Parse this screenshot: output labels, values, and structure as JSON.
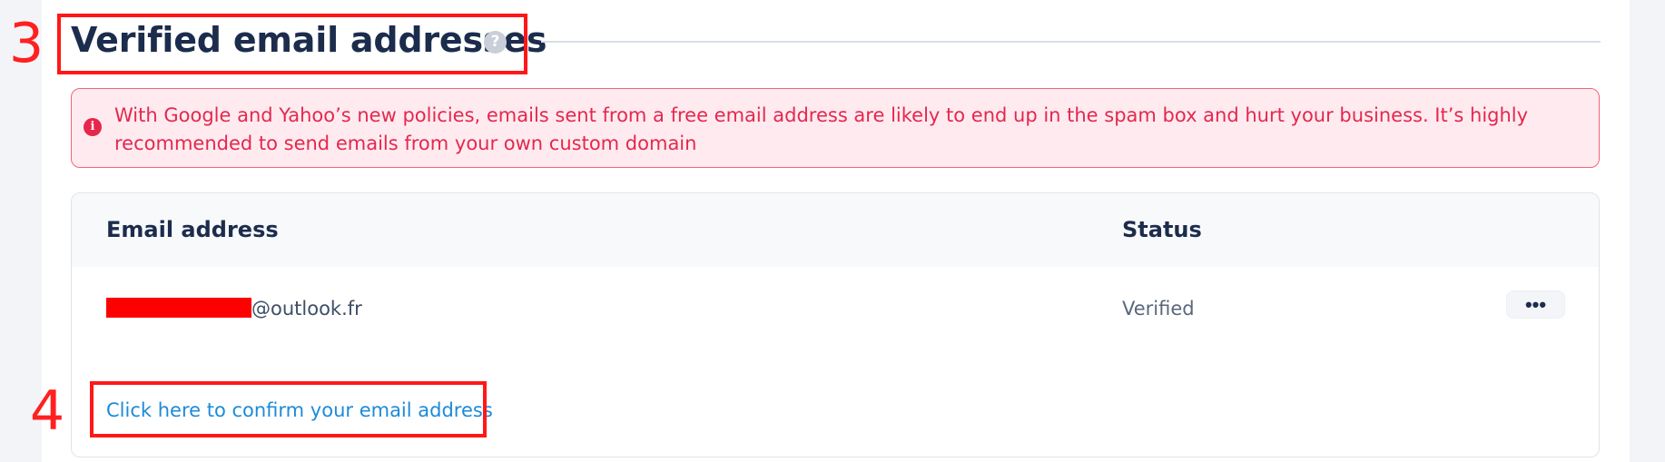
{
  "section": {
    "title": "Verified email addresses",
    "help_icon": "?"
  },
  "warning": {
    "icon": "i",
    "text": "With Google and Yahoo’s new policies, emails sent from a free email address are likely to end up in the spam box and hurt your business. It’s highly recommended to send emails from your own custom domain"
  },
  "table": {
    "headers": {
      "email": "Email address",
      "status": "Status"
    },
    "rows": [
      {
        "email_domain": "@outlook.fr",
        "status": "Verified",
        "actions_label": "•••"
      }
    ]
  },
  "confirm_link": "Click here to confirm your email address",
  "annotations": [
    "3",
    "4"
  ],
  "colors": {
    "title": "#1c2c4c",
    "warning_text": "#e5274f",
    "warning_bg": "#ffebef",
    "link": "#1d8ad8",
    "annotation": "#ff1717"
  }
}
